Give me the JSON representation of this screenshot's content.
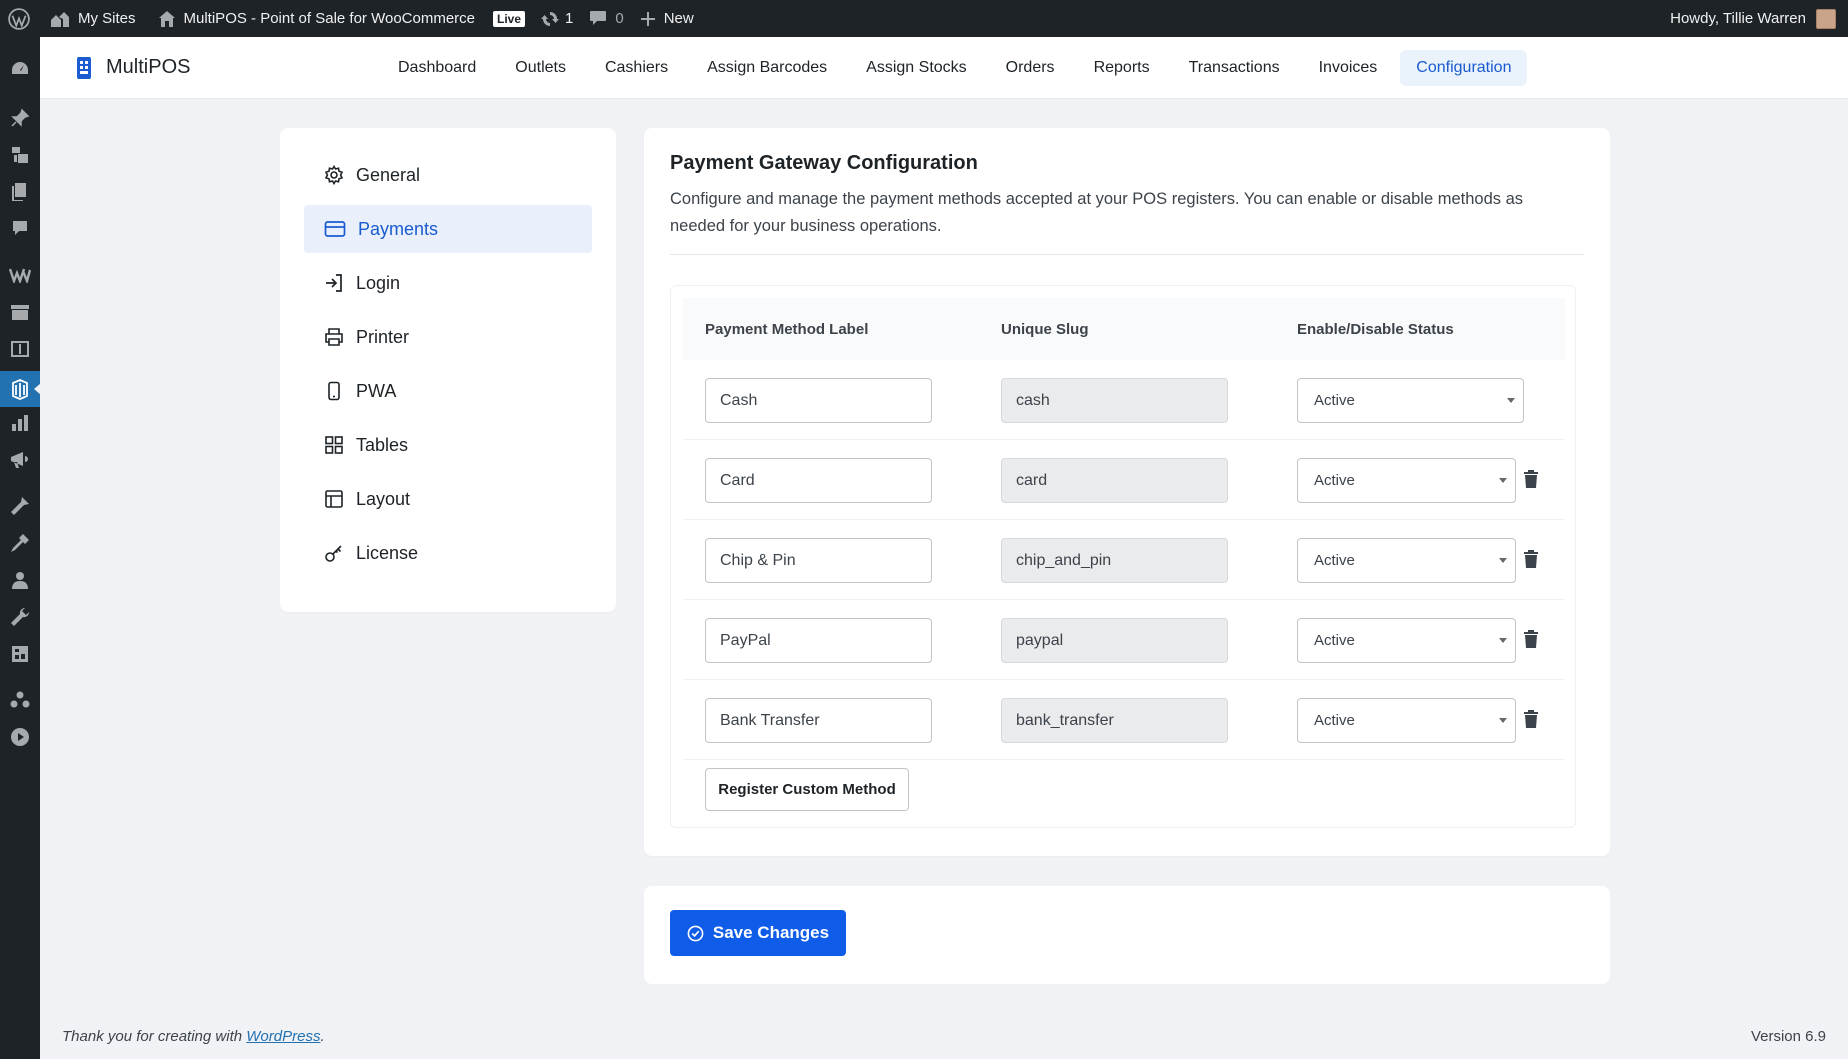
{
  "admin_bar": {
    "my_sites": "My Sites",
    "site_name": "MultiPOS - Point of Sale for WooCommerce",
    "live_badge": "Live",
    "updates_count": "1",
    "comments_count": "0",
    "new_label": "New",
    "greeting": "Howdy, Tillie Warren"
  },
  "admin_menu": {
    "icons": [
      "dashboard-icon",
      "pin-icon",
      "media-icon",
      "pages-icon",
      "comments-icon",
      "woocommerce-icon",
      "products-icon",
      "payments-icon",
      "multipos-icon",
      "analytics-icon",
      "marketing-icon",
      "appearance-icon",
      "plugins-icon",
      "users-icon",
      "tools-icon",
      "settings-icon",
      "groups-icon",
      "play-icon"
    ],
    "current": "multipos-icon"
  },
  "topnav": {
    "brand": "MultiPOS",
    "links": [
      {
        "label": "Dashboard",
        "active": false
      },
      {
        "label": "Outlets",
        "active": false
      },
      {
        "label": "Cashiers",
        "active": false
      },
      {
        "label": "Assign Barcodes",
        "active": false
      },
      {
        "label": "Assign Stocks",
        "active": false
      },
      {
        "label": "Orders",
        "active": false
      },
      {
        "label": "Reports",
        "active": false
      },
      {
        "label": "Transactions",
        "active": false
      },
      {
        "label": "Invoices",
        "active": false
      },
      {
        "label": "Configuration",
        "active": true
      }
    ],
    "accent_color": "#1a5bd0"
  },
  "settings_nav": {
    "items": [
      {
        "label": "General",
        "icon": "gear-icon",
        "active": false
      },
      {
        "label": "Payments",
        "icon": "credit-card-icon",
        "active": true
      },
      {
        "label": "Login",
        "icon": "login-icon",
        "active": false
      },
      {
        "label": "Printer",
        "icon": "printer-icon",
        "active": false
      },
      {
        "label": "PWA",
        "icon": "mobile-icon",
        "active": false
      },
      {
        "label": "Tables",
        "icon": "grid-icon",
        "active": false
      },
      {
        "label": "Layout",
        "icon": "layout-icon",
        "active": false
      },
      {
        "label": "License",
        "icon": "key-icon",
        "active": false
      }
    ]
  },
  "payment_config": {
    "title": "Payment Gateway Configuration",
    "description": "Configure and manage the payment methods accepted at your POS registers. You can enable or disable methods as needed for your business operations.",
    "columns": [
      "Payment Method Label",
      "Unique Slug",
      "Enable/Disable Status"
    ],
    "methods": [
      {
        "label": "Cash",
        "slug": "cash",
        "status": "Active",
        "deletable": false
      },
      {
        "label": "Card",
        "slug": "card",
        "status": "Active",
        "deletable": true
      },
      {
        "label": "Chip & Pin",
        "slug": "chip_and_pin",
        "status": "Active",
        "deletable": true
      },
      {
        "label": "PayPal",
        "slug": "paypal",
        "status": "Active",
        "deletable": true
      },
      {
        "label": "Bank Transfer",
        "slug": "bank_transfer",
        "status": "Active",
        "deletable": true
      }
    ],
    "register_button": "Register Custom Method"
  },
  "save": {
    "label": "Save Changes",
    "color": "#0f5ce9"
  },
  "footer": {
    "thanks_prefix": "Thank you for creating with ",
    "wordpress_link": "WordPress",
    "thanks_suffix": ".",
    "version": "Version 6.9"
  }
}
